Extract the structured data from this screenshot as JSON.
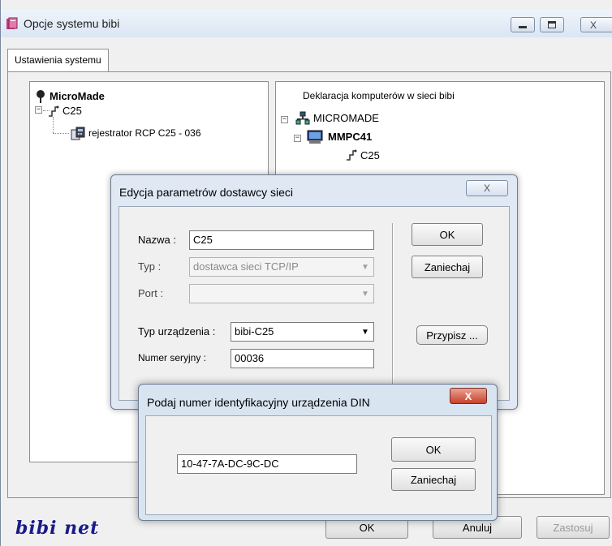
{
  "window": {
    "title": "Opcje systemu bibi",
    "minimize_label": "—",
    "maximize_label": "□",
    "close_label": "X"
  },
  "tabs": [
    {
      "label": "Ustawienia systemu"
    }
  ],
  "left_tree": {
    "root": "MicroMade",
    "child": "C25",
    "grandchild": "rejestrator RCP C25 - 036"
  },
  "right_tree": {
    "header": "Deklaracja komputerów w sieci bibi",
    "network": "MICROMADE",
    "computer": "MMPC41",
    "provider": "C25"
  },
  "footer": {
    "logo": "bibi net",
    "ok_label": "OK",
    "cancel_label": "Anuluj",
    "apply_label": "Zastosuj"
  },
  "provider_dialog": {
    "title": "Edycja parametrów dostawcy sieci",
    "close_label": "X",
    "name_label": "Nazwa :",
    "name_value": "C25",
    "type_label": "Typ :",
    "type_value": "dostawca sieci TCP/IP",
    "port_label": "Port :",
    "port_value": "",
    "device_type_label": "Typ urządzenia :",
    "device_type_value": "bibi-C25",
    "serial_label": "Numer seryjny :",
    "serial_value": "00036",
    "ok_label": "OK",
    "cancel_label": "Zaniechaj",
    "assign_label": "Przypisz ..."
  },
  "din_dialog": {
    "title": "Podaj numer identyfikacyjny urządzenia DIN",
    "close_label": "X",
    "value": "10-47-7A-DC-9C-DC",
    "ok_label": "OK",
    "cancel_label": "Zaniechaj"
  },
  "colors": {
    "logo": "#1a1a8c",
    "close_red": "#c8402a",
    "title_bar": "#dbe6f3"
  },
  "icons": [
    "app-book-icon",
    "minimize-icon",
    "maximize-icon",
    "close-icon",
    "microphone-pin-icon",
    "connector-icon",
    "recorder-device-icon",
    "network-icon",
    "computer-icon"
  ]
}
